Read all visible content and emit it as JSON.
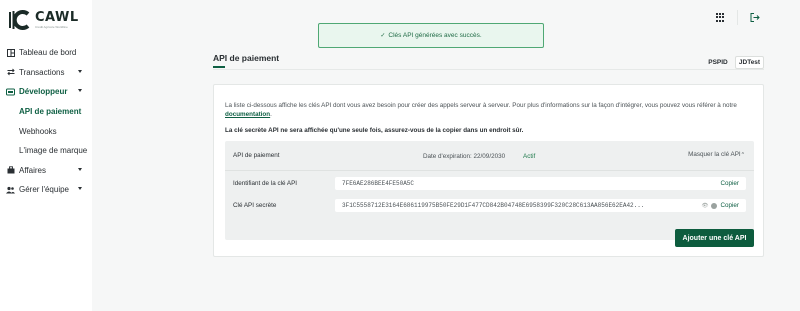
{
  "brand": {
    "name": "CAWL",
    "tagline": "Crédit Agricole Worldline"
  },
  "toast": {
    "check": "✓",
    "message": "Clés API générées avec succès."
  },
  "nav": [
    {
      "label": "Tableau de bord",
      "icon": "dashboard-icon"
    },
    {
      "label": "Transactions",
      "icon": "transactions-icon"
    },
    {
      "label": "Développeur",
      "icon": "developer-icon"
    },
    {
      "label": "API de paiement"
    },
    {
      "label": "Webhooks"
    },
    {
      "label": "L'image de marque"
    },
    {
      "label": "Affaires",
      "icon": "business-icon"
    },
    {
      "label": "Gérer l'équipe",
      "icon": "team-icon"
    }
  ],
  "header": {
    "title": "API de paiement",
    "pills": [
      "PSPID",
      "JDTest"
    ]
  },
  "card": {
    "intro_text": "La liste ci-dessous affiche les clés API dont vous avez besoin pour créer des appels serveur à serveur. Pour plus d'informations sur la façon d'intégrer, vous pouvez vous référer à notre ",
    "intro_link": "documentation",
    "intro_end": ".",
    "warning": "La clé secrète API ne sera affichée qu'une seule fois, assurez-vous de la copier dans un endroit sûr.",
    "panel": {
      "title": "API de paiement",
      "expiration": "Date d'expiration: 22/09/2030",
      "status": "Actif",
      "hide_label": "Masquer la clé API",
      "hide_chevron": "^",
      "key_id_label": "Identifiant de la clé API",
      "key_id_value": "7FE6AE286BEE4FE50A5C",
      "secret_label": "Clé API secrète",
      "secret_value": "3F1C5558712E3164E686119975B50FE29D1F477CD842B04748E6958399F320C28C613AA856E62EA42...",
      "eye_glyph": "👁",
      "copy_label": "Copier"
    },
    "add_button": "Ajouter une clé API"
  },
  "colors": {
    "brand_green": "#0e5f43",
    "button_green": "#0d5c3e",
    "toast_border": "#4fa874",
    "toast_bg": "#e9f6ee"
  }
}
